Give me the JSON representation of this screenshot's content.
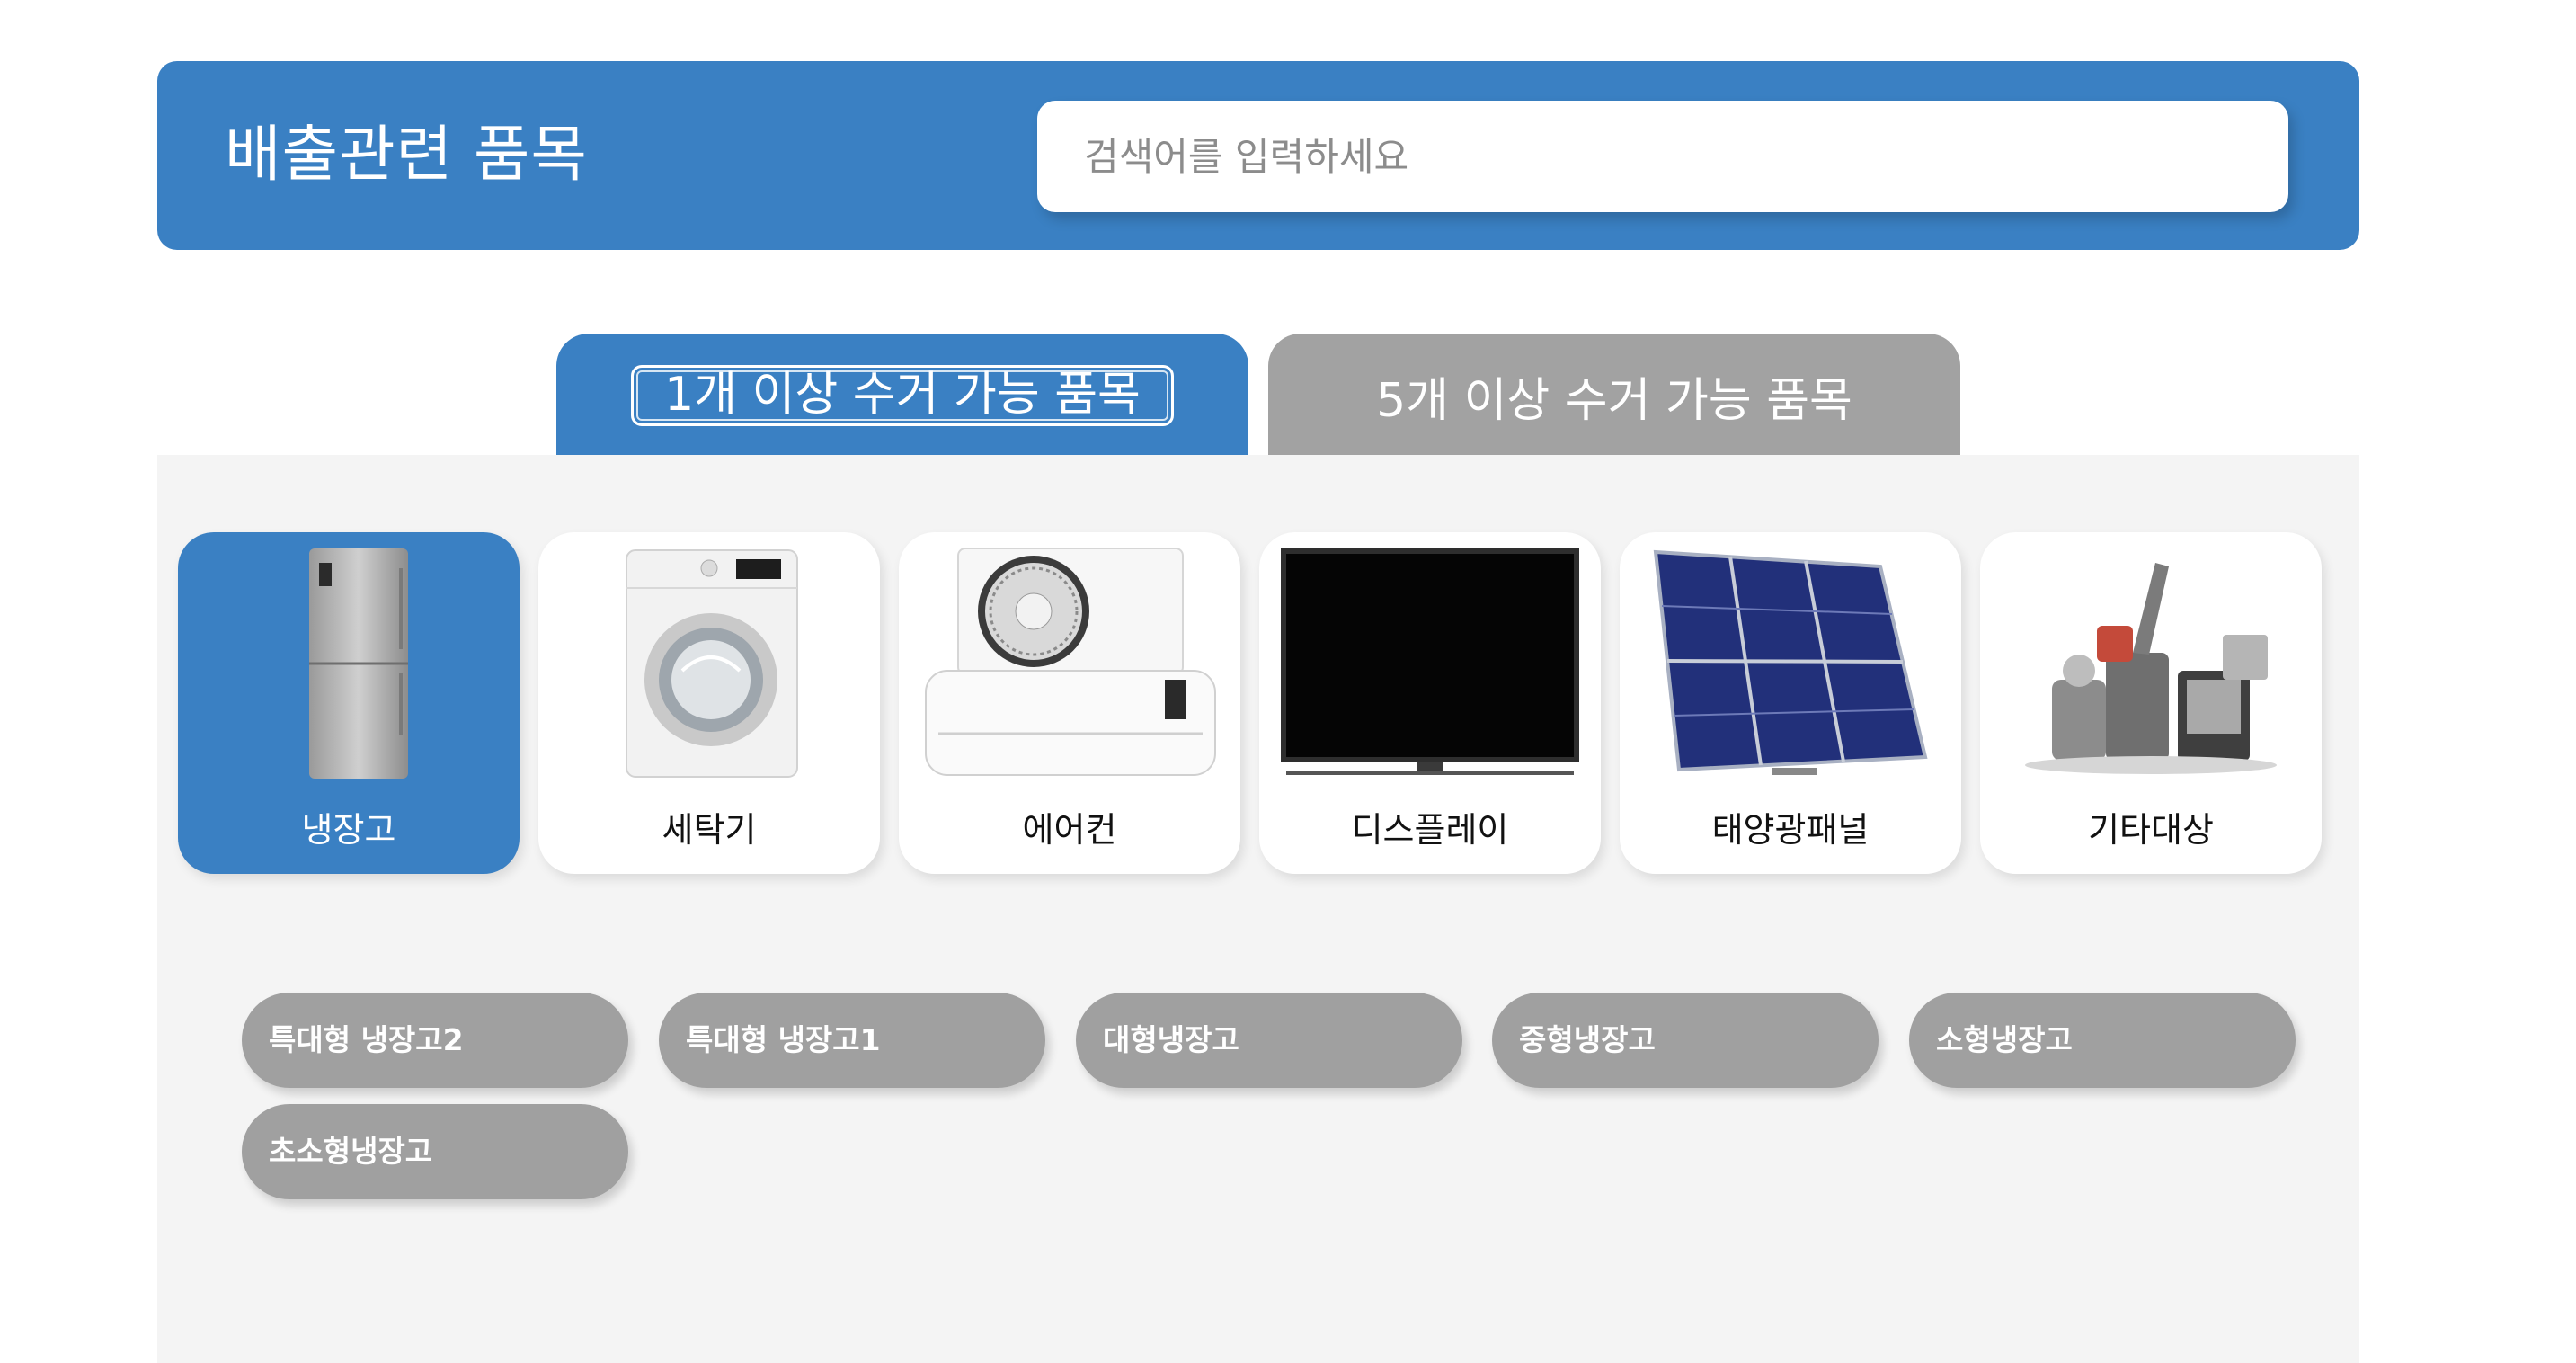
{
  "header": {
    "title": "배출관련 품목",
    "search_placeholder": "검색어를 입력하세요"
  },
  "tabs": [
    {
      "label": "1개 이상 수거 가능 품목",
      "active": true
    },
    {
      "label": "5개 이상 수거 가능 품목",
      "active": false
    }
  ],
  "categories": [
    {
      "label": "냉장고",
      "icon": "refrigerator-icon",
      "active": true
    },
    {
      "label": "세탁기",
      "icon": "washing-machine-icon",
      "active": false
    },
    {
      "label": "에어컨",
      "icon": "air-conditioner-icon",
      "active": false
    },
    {
      "label": "디스플레이",
      "icon": "display-icon",
      "active": false
    },
    {
      "label": "태양광패널",
      "icon": "solar-panel-icon",
      "active": false
    },
    {
      "label": "기타대상",
      "icon": "appliances-icon",
      "active": false
    }
  ],
  "items": [
    "특대형 냉장고2",
    "특대형 냉장고1",
    "대형냉장고",
    "중형냉장고",
    "소형냉장고",
    "초소형냉장고"
  ],
  "colors": {
    "accent": "#3a80c3",
    "inactive": "#a2a2a2",
    "chip": "#a0a0a0",
    "panel": "#f4f4f4"
  }
}
